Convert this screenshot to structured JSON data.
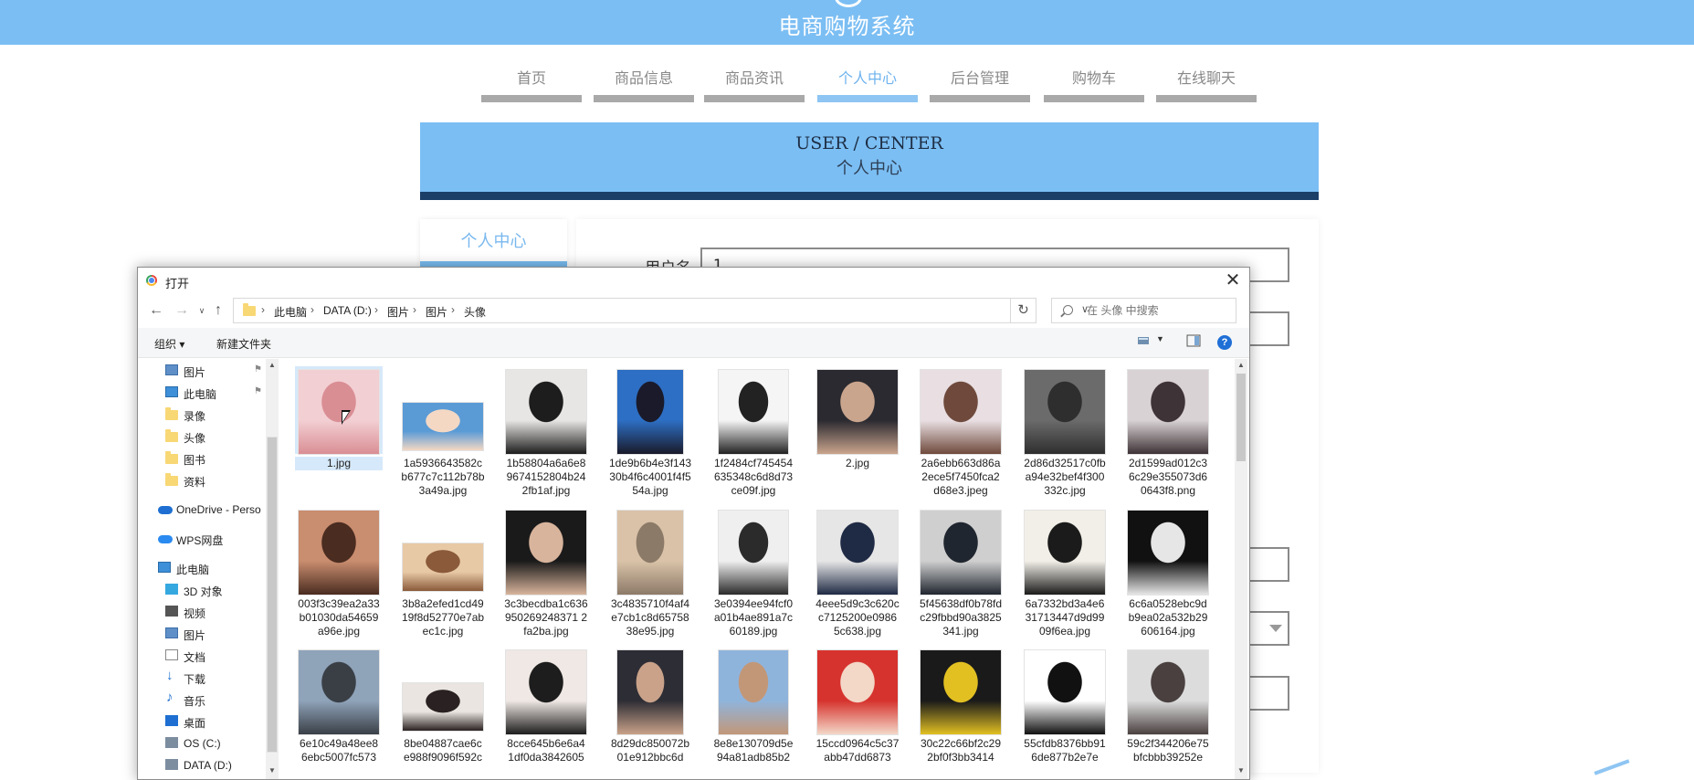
{
  "site": {
    "title": "电商购物系统",
    "nav": [
      {
        "label": "首页",
        "active": false
      },
      {
        "label": "商品信息",
        "active": false
      },
      {
        "label": "商品资讯",
        "active": false
      },
      {
        "label": "个人中心",
        "active": true
      },
      {
        "label": "后台管理",
        "active": false
      },
      {
        "label": "购物车",
        "active": false
      },
      {
        "label": "在线聊天",
        "active": false
      }
    ],
    "banner": {
      "en": "USER / CENTER",
      "cn": "个人中心"
    },
    "side_tab": "个人中心",
    "form": {
      "username_label": "用户名",
      "username_value": "1"
    }
  },
  "dialog": {
    "title": "打开",
    "close_glyph": "✕",
    "breadcrumb": [
      "此电脑",
      "DATA (D:)",
      "图片",
      "图片",
      "头像"
    ],
    "search_placeholder": "在 头像 中搜索",
    "commands": {
      "organize": "组织 ▾",
      "new_folder": "新建文件夹"
    },
    "nav_pane": [
      {
        "label": "图片",
        "icon": "picture-folder-icon",
        "pinned": true
      },
      {
        "label": "此电脑",
        "icon": "computer-icon",
        "pinned": true
      },
      {
        "label": "录像",
        "icon": "folder-icon"
      },
      {
        "label": "头像",
        "icon": "folder-icon"
      },
      {
        "label": "图书",
        "icon": "folder-icon"
      },
      {
        "label": "资料",
        "icon": "folder-icon"
      },
      {
        "label": "OneDrive - Perso",
        "icon": "onedrive-icon"
      },
      {
        "label": "WPS网盘",
        "icon": "wps-cloud-icon"
      },
      {
        "label": "此电脑",
        "icon": "computer-icon"
      },
      {
        "label": "3D 对象",
        "icon": "3d-objects-icon"
      },
      {
        "label": "视频",
        "icon": "video-icon"
      },
      {
        "label": "图片",
        "icon": "picture-folder-icon"
      },
      {
        "label": "文档",
        "icon": "document-icon"
      },
      {
        "label": "下载",
        "icon": "download-icon"
      },
      {
        "label": "音乐",
        "icon": "music-icon"
      },
      {
        "label": "桌面",
        "icon": "desktop-icon"
      },
      {
        "label": "OS (C:)",
        "icon": "drive-icon"
      },
      {
        "label": "DATA (D:)",
        "icon": "drive-icon"
      }
    ],
    "files": [
      {
        "name": "1.jpg",
        "selected": true,
        "colors": [
          "#f2cfd3",
          "#d98e94"
        ]
      },
      {
        "name": "1a5936643582cb677c7c112b78b3a49a.jpg",
        "colors": [
          "#5a9bd6",
          "#f4d8c4"
        ]
      },
      {
        "name": "1b58804a6a6e89674152804b242fb1af.jpg",
        "colors": [
          "#e8e6e4",
          "#1d1d1d"
        ]
      },
      {
        "name": "1de9b6b4e3f14330b4f6c4001f4f554a.jpg",
        "colors": [
          "#2d6fc4",
          "#1a1a2a"
        ]
      },
      {
        "name": "1f2484cf745454635348c6d8d73ce09f.jpg",
        "colors": [
          "#f5f5f5",
          "#222222"
        ]
      },
      {
        "name": "2.jpg",
        "colors": [
          "#2a2a30",
          "#caa58d"
        ]
      },
      {
        "name": "2a6ebb663d86a2ece5f7450fca2d68e3.jpeg",
        "colors": [
          "#e9dfe3",
          "#6f4a3c"
        ]
      },
      {
        "name": "2d86d32517c0fba94e32bef4f300332c.jpg",
        "colors": [
          "#6b6b6b",
          "#2e2e2e"
        ]
      },
      {
        "name": "2d1599ad012c36c29e355073d60643f8.png",
        "colors": [
          "#d9d2d4",
          "#3e3336"
        ]
      },
      {
        "name": "003f3c39ea2a33b01030da54659a96e.jpg",
        "colors": [
          "#c98d6f",
          "#4a2c20"
        ]
      },
      {
        "name": "3b8a2efed1cd4919f8d52770e7abec1c.jpg",
        "colors": [
          "#e8c9a6",
          "#8a5a3a"
        ]
      },
      {
        "name": "3c3becdba1c636950269248371 2fa2ba.jpg",
        "colors": [
          "#1a1a1a",
          "#d8b49c"
        ]
      },
      {
        "name": "3c4835710f4af4e7cb1c8d6575838e95.jpg",
        "colors": [
          "#d9c2a8",
          "#8c7a68"
        ]
      },
      {
        "name": "3e0394ee94fcf0a01b4ae891a7c60189.jpg",
        "colors": [
          "#efefef",
          "#2b2b2b"
        ]
      },
      {
        "name": "4eee5d9c3c620cc7125200e09865c638.jpg",
        "colors": [
          "#e6e6e6",
          "#1f2a44"
        ]
      },
      {
        "name": "5f45638df0b78fdc29fbbd90a3825341.jpg",
        "colors": [
          "#cfcfcf",
          "#20262f"
        ]
      },
      {
        "name": "6a7332bd3a4e631713447d9d9909f6ea.jpg",
        "colors": [
          "#f2efe8",
          "#1b1b1b"
        ]
      },
      {
        "name": "6c6a0528ebc9db9ea02a532b29606164.jpg",
        "colors": [
          "#111111",
          "#e6e6e6"
        ]
      },
      {
        "name": "6e10c49a48ee86ebc5007fc573",
        "colors": [
          "#8fa3b9",
          "#3a3f46"
        ]
      },
      {
        "name": "8be04887cae6ce988f9096f592c",
        "colors": [
          "#eae5e0",
          "#2a2222"
        ]
      },
      {
        "name": "8cce645b6e6a41df0da3842605",
        "colors": [
          "#efe8e4",
          "#1d1d1d"
        ]
      },
      {
        "name": "8d29dc850072b01e912bbc6d",
        "colors": [
          "#2d2d35",
          "#c9a289"
        ]
      },
      {
        "name": "8e8e130709d5e94a81adb85b2",
        "colors": [
          "#8fb4dc",
          "#c29778"
        ]
      },
      {
        "name": "15ccd0964c5c37abb47dd6873",
        "colors": [
          "#d6332e",
          "#f3d7c7"
        ]
      },
      {
        "name": "30c22c66bf2c292bf0f3bb3414",
        "colors": [
          "#1a1a1a",
          "#e2c022"
        ]
      },
      {
        "name": "55cfdb8376bb916de877b2e7e",
        "colors": [
          "#ffffff",
          "#111111"
        ]
      },
      {
        "name": "59c2f344206e75bfcbbb39252e",
        "colors": [
          "#dcdcdc",
          "#4a4040"
        ]
      }
    ]
  }
}
